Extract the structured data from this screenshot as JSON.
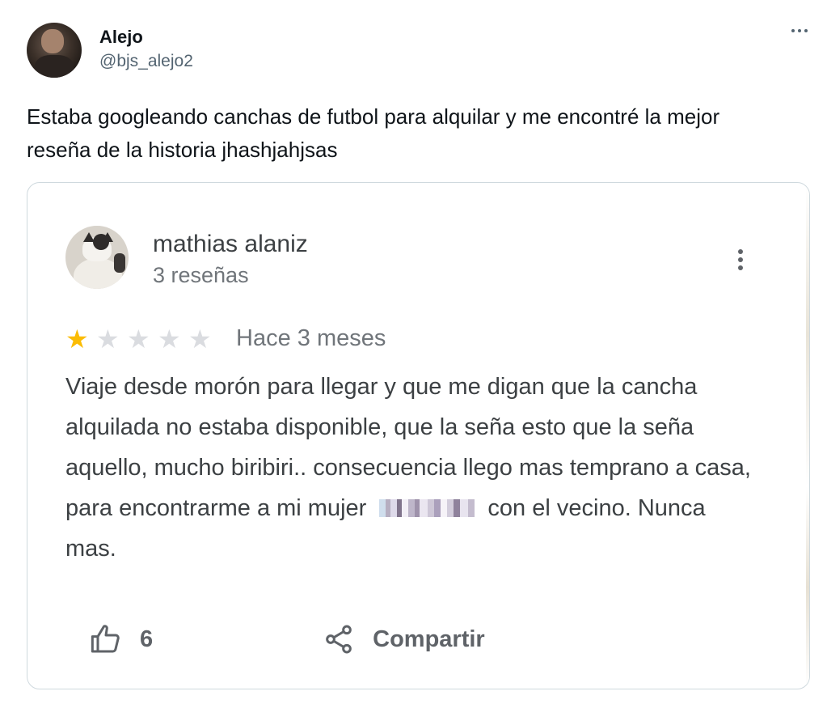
{
  "tweet": {
    "author": {
      "display_name": "Alejo",
      "handle": "@bjs_alejo2"
    },
    "more_icon": "ellipsis-horizontal-icon",
    "text": "Estaba googleando canchas de futbol para alquilar y me encontré la mejor reseña de la historia jhashjahjsas"
  },
  "review": {
    "reviewer": {
      "name": "mathias alaniz",
      "reviews_count": "3 reseñas"
    },
    "menu_icon": "kebab-menu-icon",
    "rating": 1,
    "rating_max": 5,
    "time_ago": "Hace 3 meses",
    "text_before_redaction": "Viaje desde morón para llegar y que me digan que la cancha alquilada no estaba disponible, que la seña esto que la seña aquello, mucho biribiri.. consecuencia llego mas temprano a casa, para encontrarme a mi mujer ",
    "text_after_redaction": " con el vecino. Nunca mas.",
    "actions": {
      "like_icon": "thumbs-up-icon",
      "like_count": "6",
      "share_icon": "share-icon",
      "share_label": "Compartir"
    },
    "colors": {
      "star_filled": "#fbbc04",
      "star_empty": "#dadce0",
      "text": "#3c4043",
      "secondary": "#70757a"
    }
  }
}
